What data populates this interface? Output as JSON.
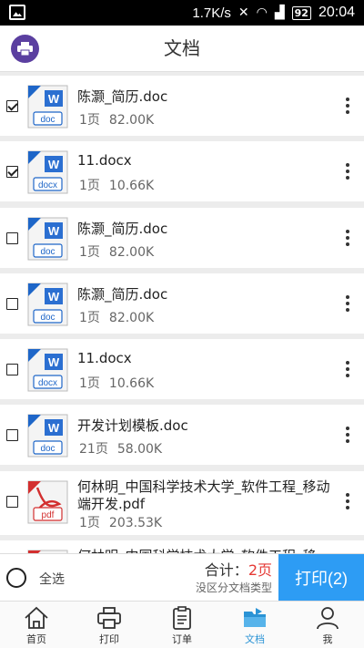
{
  "status_bar": {
    "speed": "1.7K/s",
    "battery": "92",
    "time": "20:04"
  },
  "header": {
    "title": "文档"
  },
  "files": [
    {
      "name": "陈灏_简历.doc",
      "ext": "doc",
      "pages": "1页",
      "size": "82.00K",
      "checked": true
    },
    {
      "name": "11.docx",
      "ext": "docx",
      "pages": "1页",
      "size": "10.66K",
      "checked": true
    },
    {
      "name": "陈灏_简历.doc",
      "ext": "doc",
      "pages": "1页",
      "size": "82.00K",
      "checked": false
    },
    {
      "name": "陈灏_简历.doc",
      "ext": "doc",
      "pages": "1页",
      "size": "82.00K",
      "checked": false
    },
    {
      "name": "11.docx",
      "ext": "docx",
      "pages": "1页",
      "size": "10.66K",
      "checked": false
    },
    {
      "name": "开发计划模板.doc",
      "ext": "doc",
      "pages": "21页",
      "size": "58.00K",
      "checked": false
    },
    {
      "name": "何林明_中国科学技术大学_软件工程_移动端开发.pdf",
      "ext": "pdf",
      "pages": "1页",
      "size": "203.53K",
      "checked": false
    },
    {
      "name": "何林明_中国科学技术大学_软件工程_移",
      "ext": "pdf",
      "pages": "",
      "size": "",
      "checked": false
    }
  ],
  "action_bar": {
    "select_all": "全选",
    "total_label": "合计：",
    "total_value": "2页",
    "hint": "没区分文档类型",
    "print_label": "打印(2)"
  },
  "tabs": [
    {
      "label": "首页",
      "icon": "home-icon",
      "active": false
    },
    {
      "label": "打印",
      "icon": "printer-icon",
      "active": false
    },
    {
      "label": "订单",
      "icon": "order-icon",
      "active": false
    },
    {
      "label": "文档",
      "icon": "folder-icon",
      "active": true
    },
    {
      "label": "我",
      "icon": "person-icon",
      "active": false
    }
  ],
  "colors": {
    "accent": "#2d9cf4",
    "header_button": "#5b3fa0",
    "total_value": "#e53935",
    "active_tab": "#2a93d5"
  }
}
